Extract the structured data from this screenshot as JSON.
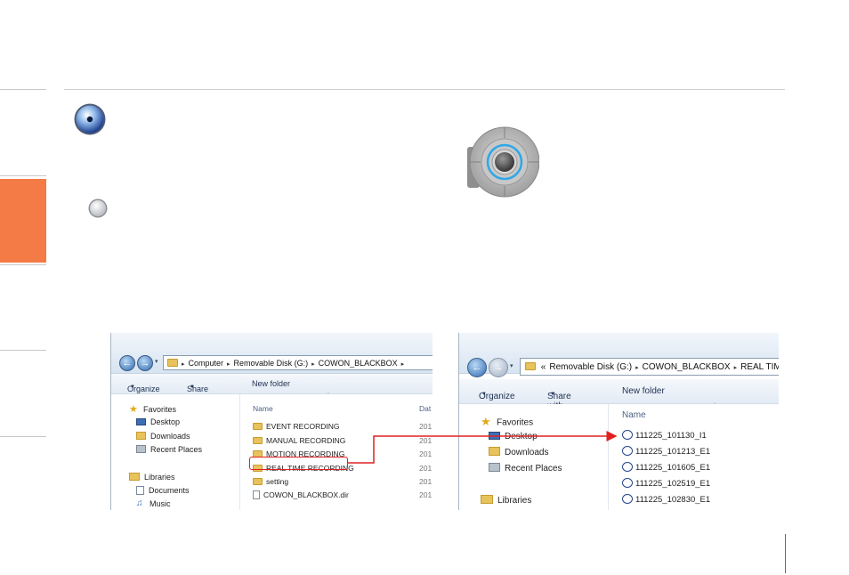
{
  "left_window": {
    "breadcrumb": [
      "Computer",
      "Removable Disk (G:)",
      "COWON_BLACKBOX"
    ],
    "toolbar": {
      "organize": "Organize",
      "share_with": "Share with",
      "new_folder": "New folder"
    },
    "nav": {
      "favorites": "Favorites",
      "desktop": "Desktop",
      "downloads": "Downloads",
      "recent_places": "Recent Places",
      "libraries": "Libraries",
      "documents": "Documents",
      "music": "Music"
    },
    "columns": {
      "name": "Name",
      "date": "Dat"
    },
    "files": [
      {
        "name": "EVENT RECORDING",
        "date": "201"
      },
      {
        "name": "MANUAL RECORDING",
        "date": "201"
      },
      {
        "name": "MOTION RECORDING",
        "date": "201"
      },
      {
        "name": "REAL TIME RECORDING",
        "date": "201"
      },
      {
        "name": "setting",
        "date": "201"
      },
      {
        "name": "COWON_BLACKBOX.dir",
        "date": "201"
      }
    ]
  },
  "right_window": {
    "breadcrumb_prefix": "«",
    "breadcrumb": [
      "Removable Disk (G:)",
      "COWON_BLACKBOX",
      "REAL TIM"
    ],
    "toolbar": {
      "organize": "Organize",
      "share_with": "Share with",
      "new_folder": "New folder"
    },
    "nav": {
      "favorites": "Favorites",
      "desktop": "Desktop",
      "downloads": "Downloads",
      "recent_places": "Recent Places",
      "libraries": "Libraries"
    },
    "columns": {
      "name": "Name"
    },
    "files": [
      "111225_101130_I1",
      "111225_101213_E1",
      "111225_101605_E1",
      "111225_102519_E1",
      "111225_102830_E1"
    ]
  },
  "colors": {
    "side_tab": "#f47b45",
    "annotation": "#e02020"
  }
}
